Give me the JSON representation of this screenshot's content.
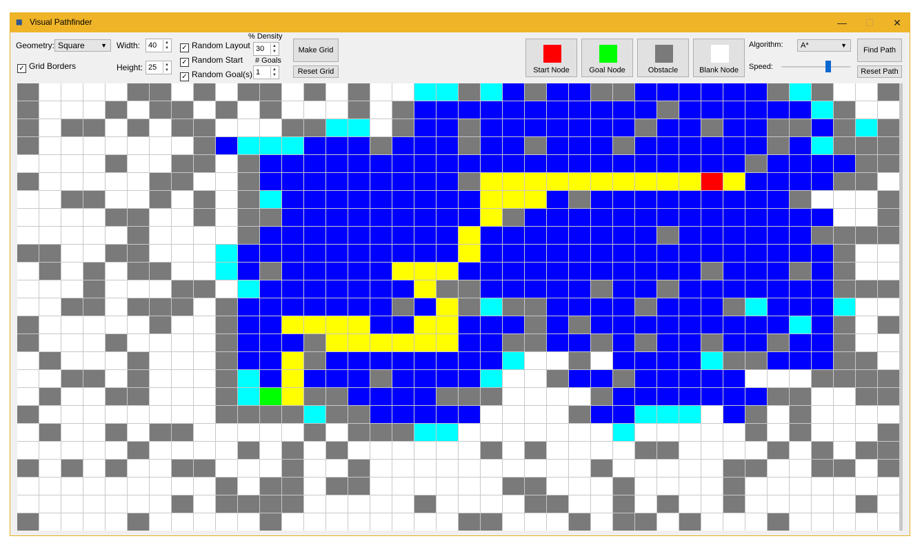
{
  "window": {
    "title": "Visual Pathfinder",
    "icon": "app-logo-icon",
    "minimize": "—",
    "maximize": "☐",
    "close": "✕"
  },
  "controls": {
    "geometry_label": "Geometry:",
    "geometry_value": "Square",
    "grid_borders_label": "Grid Borders",
    "grid_borders_checked": true,
    "width_label": "Width:",
    "width_value": "40",
    "height_label": "Height:",
    "height_value": "25",
    "random_layout_label": "Random Layout",
    "random_start_label": "Random Start",
    "random_goals_label": "Random Goal(s)",
    "density_label": "% Density",
    "density_value": "30",
    "goals_label": "# Goals",
    "goals_value": "1",
    "make_grid": "Make Grid",
    "reset_grid": "Reset Grid",
    "start_node": "Start Node",
    "goal_node": "Goal Node",
    "obstacle": "Obstacle",
    "blank_node": "Blank Node",
    "algorithm_label": "Algorithm:",
    "algorithm_value": "A*",
    "speed_label": "Speed:",
    "speed_level": 0.7,
    "find_path": "Find Path",
    "reset_path": "Reset Path"
  },
  "colors": {
    "blank": "#ffffff",
    "obstacle": "#7a7a7a",
    "visited": "#0000ff",
    "frontier": "#00ffff",
    "path": "#ffff00",
    "start": "#ff0000",
    "goal": "#00ff00"
  },
  "grid": {
    "columns": 40,
    "legend": "0=blank 1=obstacle 2=visited 3=frontier 4=path 5=start 6=goal",
    "rows": [
      "1000011010110101003313212211222222131001111",
      "1000101101010001012222222222212222223100",
      "1011010110001133012212222222122122112131",
      "1000000012333222122212212221222222123111",
      "0000100110122222222222222222222221222211",
      "1000001100122222222214444444444542222110",
      "0011001010132222222224442122222222210001",
      "0000110010112222222224122222222222222001",
      "0000010000122222222242222222212222221111",
      "1100110003222222222242222222222222222100",
      "0101011003212222244422222222222122212100",
      "0001000110322222224112222212212222222111",
      "0011011101222222212413112222122213222300",
      "1000001001224444224422212122222222232101",
      "1000100001222144444422112212122122122100",
      "0100010001224122222222300102222311222110",
      "0011010001324222122223001221222220001111",
      "0100110001364112222111000012222222110011",
      "1000000001111311222220000122333021010000",
      "0100101100000101113300000003000001010001",
      "0000010000101010000001010000110000101011",
      "1010100110001001000000000010000011001101",
      "0000000001011011000000110001000010000000",
      "0000000101111000001000011001010010000010",
      "1000010000010000000011000101101000100000"
    ]
  }
}
